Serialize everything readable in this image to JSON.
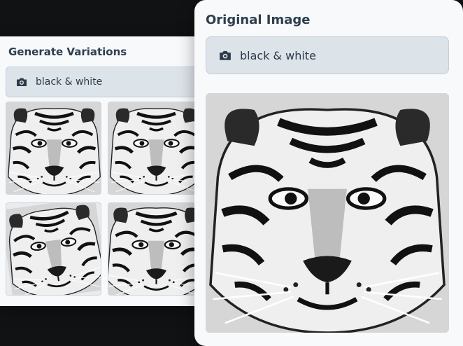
{
  "variations_panel": {
    "title": "Generate Variations",
    "prompt_text": "black & white",
    "prompt_icon": "camera-icon",
    "thumbnails": [
      {
        "subject": "tiger"
      },
      {
        "subject": "tiger"
      },
      {
        "subject": "tiger"
      },
      {
        "subject": "tiger"
      }
    ]
  },
  "original_panel": {
    "title": "Original Image",
    "prompt_text": "black & white",
    "prompt_icon": "camera-icon"
  },
  "colors": {
    "background": "#111214",
    "card": "#f7f9fa",
    "prompt_bg": "#dde4e9",
    "title": "#2c3e50"
  }
}
